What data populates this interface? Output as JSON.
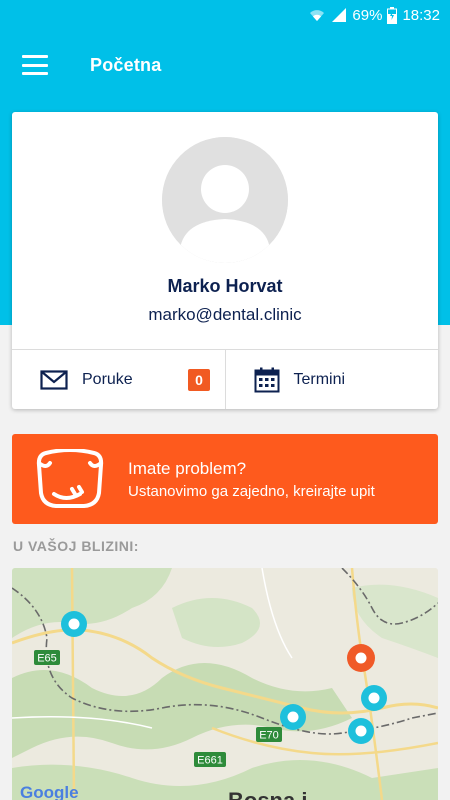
{
  "status_bar": {
    "battery": "69%",
    "time": "18:32"
  },
  "app_bar": {
    "title": "Početna",
    "menu_icon": "hamburger-menu-icon"
  },
  "profile": {
    "name": "Marko Horvat",
    "email": "marko@dental.clinic",
    "avatar_icon": "default-avatar-icon"
  },
  "actions": {
    "messages_label": "Poruke",
    "messages_count": "0",
    "appointments_label": "Termini"
  },
  "problem_banner": {
    "title": "Imate problem?",
    "subtitle": "Ustanovimo ga zajedno, kreirajte upit",
    "icon": "tooth-icon"
  },
  "nearby": {
    "label": "U VAŠOJ BLIZINI:",
    "road_labels": [
      "E65",
      "E70",
      "E661"
    ],
    "place_label": "Bosna i",
    "map_attribution": "Google"
  },
  "colors": {
    "primary": "#00c0e8",
    "accent": "#fe5a1d",
    "text_dark": "#0d2150",
    "marker_blue": "#1ec0dc",
    "marker_orange": "#f05a28"
  }
}
